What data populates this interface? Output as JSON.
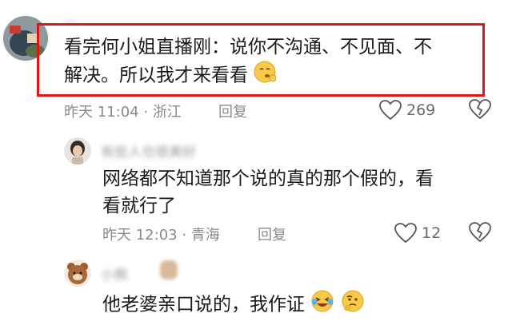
{
  "comments": [
    {
      "text_line1": "看完何小姐直播刚：说你不沟通、不见面、不",
      "text_line2": "解决。所以我才来看看",
      "meta": "昨天 11:04 · 浙江",
      "reply_label": "回复",
      "likes": "269"
    },
    {
      "username": "有些人也很美好",
      "text_line1": "网络都不知道那个说的真的那个假的，看",
      "text_line2": "看就行了",
      "meta": "昨天 12:03 · 青海",
      "reply_label": "回复",
      "likes": "12"
    },
    {
      "username": "小熊",
      "text_line1": "他老婆亲口说的，我作证"
    }
  ],
  "colors": {
    "highlight": "#e01616",
    "meta": "#8a8a8a"
  },
  "icons": [
    "heart-outline-icon",
    "broken-heart-icon",
    "face-emoji-icon",
    "laughing-emoji-icon",
    "thinking-emoji-icon"
  ]
}
